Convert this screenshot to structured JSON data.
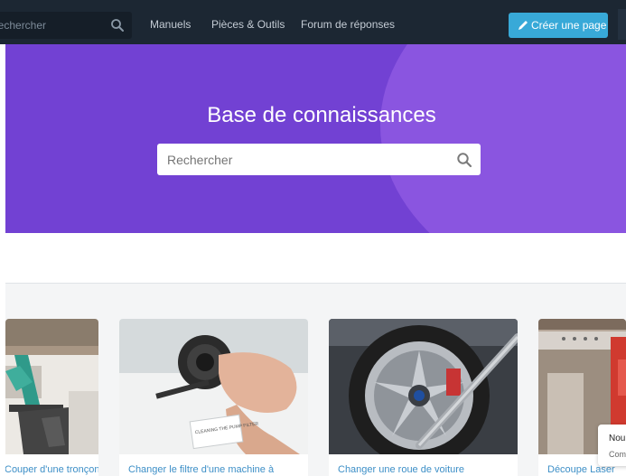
{
  "nav": {
    "search_placeholder": "Rechercher",
    "links": [
      "Manuels",
      "Pièces & Outils",
      "Forum de réponses"
    ],
    "create_button": "Créer une page"
  },
  "hero": {
    "title": "Base de connaissances",
    "search_placeholder": "Rechercher"
  },
  "cards": [
    {
      "title": "Couper d'une tronçon",
      "icon": "saw-photo"
    },
    {
      "title": "Changer le filtre d'une machine à",
      "icon": "pump-filter-photo",
      "photo_caption": "CLEANING THE PUMP FILTER"
    },
    {
      "title": "Changer une roue de voiture",
      "icon": "car-wheel-photo"
    },
    {
      "title": "Découpe Laser",
      "icon": "laser-cutter-photo"
    }
  ],
  "toast": {
    "line1": "Nou",
    "line2": "Com"
  },
  "colors": {
    "nav_bg": "#1c2733",
    "hero_bg": "#7241d3",
    "accent": "#38a9d8",
    "link": "#3d8fc7"
  }
}
